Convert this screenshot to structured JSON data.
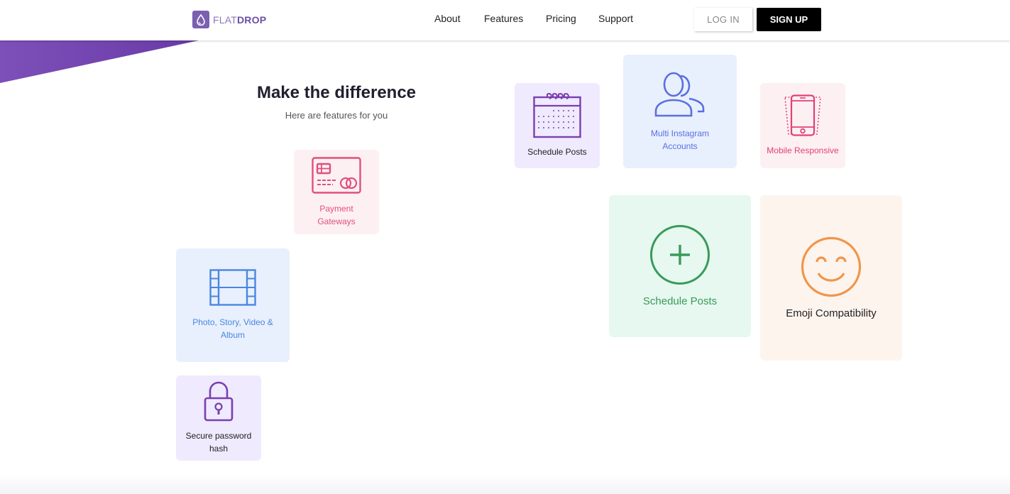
{
  "brand": {
    "flat": "FLAT",
    "drop": "DROP",
    "logo_color": "#7b5fb0"
  },
  "nav": {
    "items": [
      {
        "label": "About"
      },
      {
        "label": "Features"
      },
      {
        "label": "Pricing"
      },
      {
        "label": "Support"
      }
    ],
    "login_label": "LOG IN",
    "signup_label": "SIGN UP"
  },
  "hero": {
    "title": "Make the difference",
    "subtitle": "Here are features for you"
  },
  "features": {
    "payment": {
      "label": "Payment Gateways",
      "color": "#e0507a",
      "icon": "credit-card-icon"
    },
    "photo": {
      "label": "Photo, Story, Video & Album",
      "color": "#4a86e0",
      "icon": "film-icon"
    },
    "lock": {
      "label": "Secure password hash",
      "color": "#7a3fb0",
      "icon": "lock-icon"
    },
    "schedule_small": {
      "label": "Schedule Posts",
      "color": "#7a3fb0",
      "icon": "calendar-icon"
    },
    "multi": {
      "label": "Multi Instagram Accounts",
      "color": "#5a6fe0",
      "icon": "users-icon"
    },
    "mobile": {
      "label": "Mobile Responsive",
      "color": "#e0407a",
      "icon": "smartphone-icon"
    },
    "schedule_large": {
      "label": "Schedule Posts",
      "color": "#3a9a5a",
      "icon": "plus-circle-icon"
    },
    "emoji": {
      "label": "Emoji Compatibility",
      "color": "#f0964a",
      "icon": "smile-icon"
    }
  }
}
